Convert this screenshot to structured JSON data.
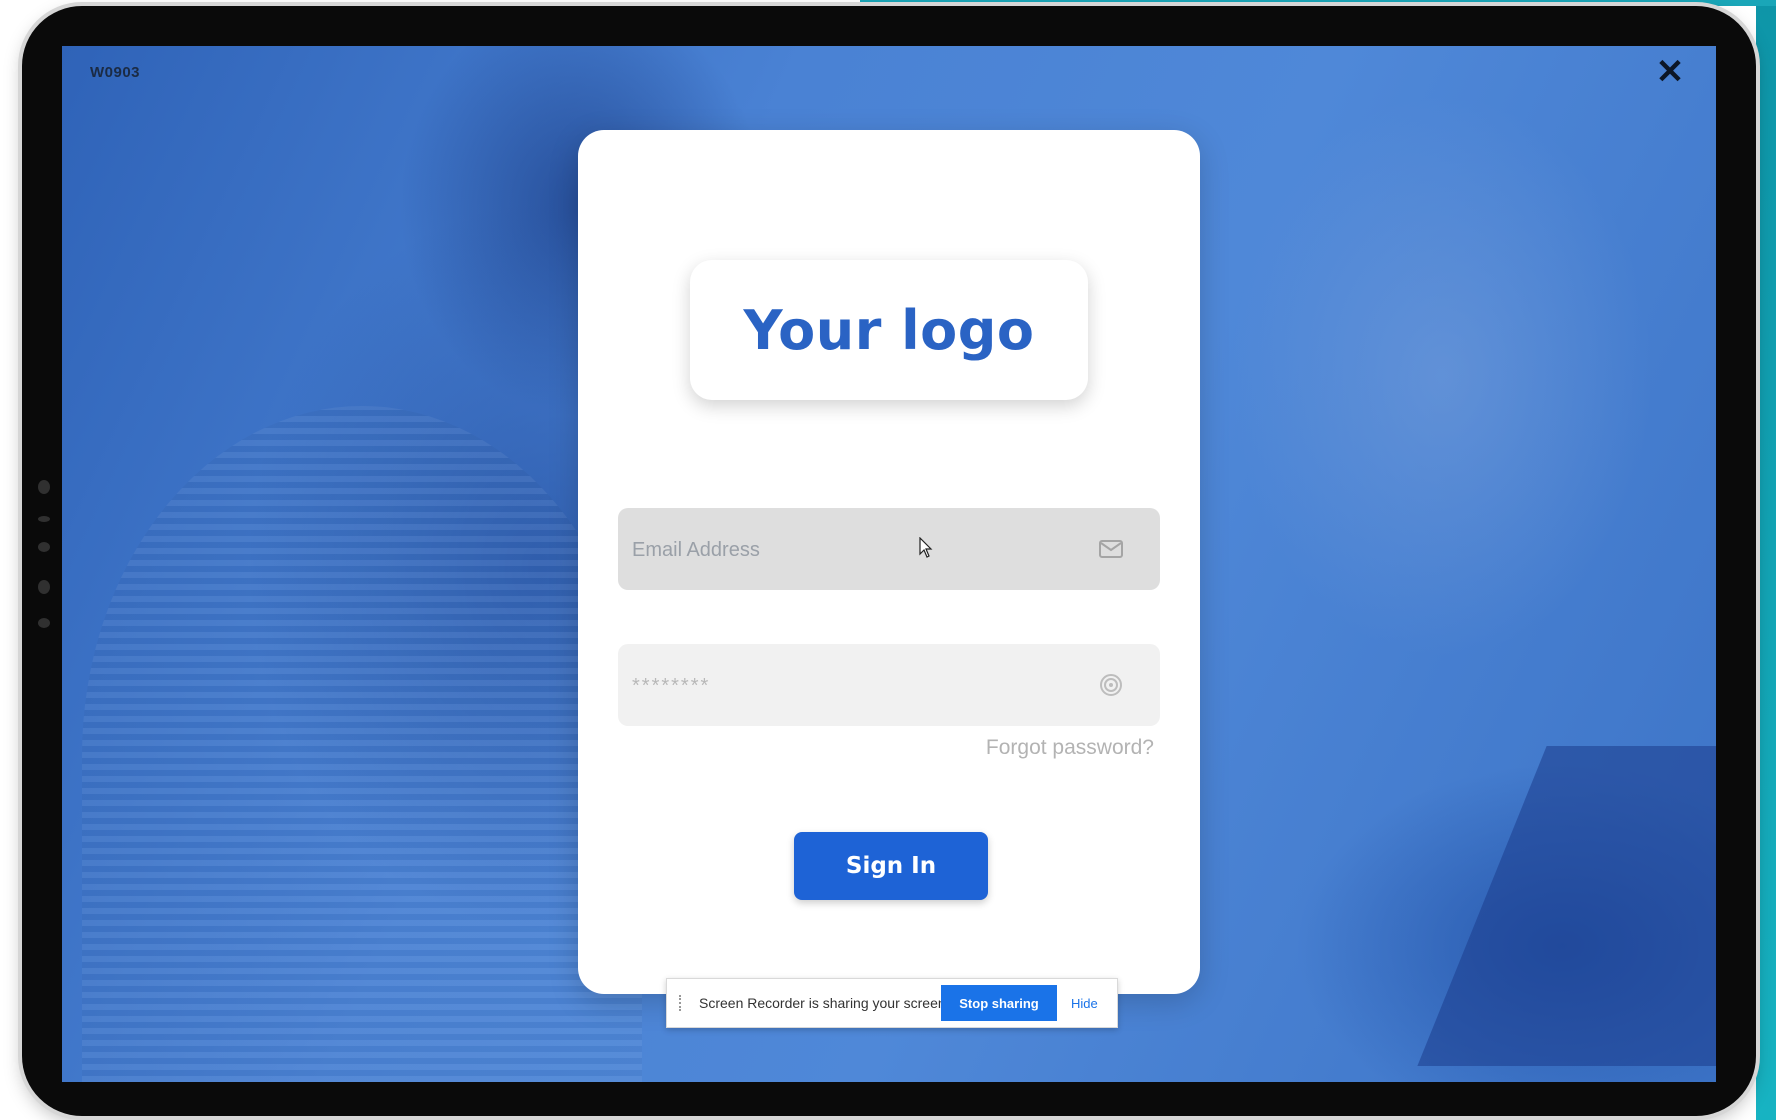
{
  "window": {
    "id_label": "W0903",
    "close_glyph": "✕"
  },
  "login": {
    "logo_text": "Your logo",
    "email_placeholder": "Email Address",
    "password_placeholder": "********",
    "forgot_password": "Forgot password?",
    "sign_in": "Sign In"
  },
  "share_bar": {
    "message": "Screen Recorder is sharing your screen.",
    "stop_button": "Stop sharing",
    "hide_link": "Hide"
  },
  "icons": {
    "email": "envelope-icon",
    "password": "fingerprint-icon",
    "close": "close-icon"
  },
  "colors": {
    "accent": "#1e63d6",
    "logo": "#2a63c4",
    "background_tint": "#3f78cc"
  }
}
